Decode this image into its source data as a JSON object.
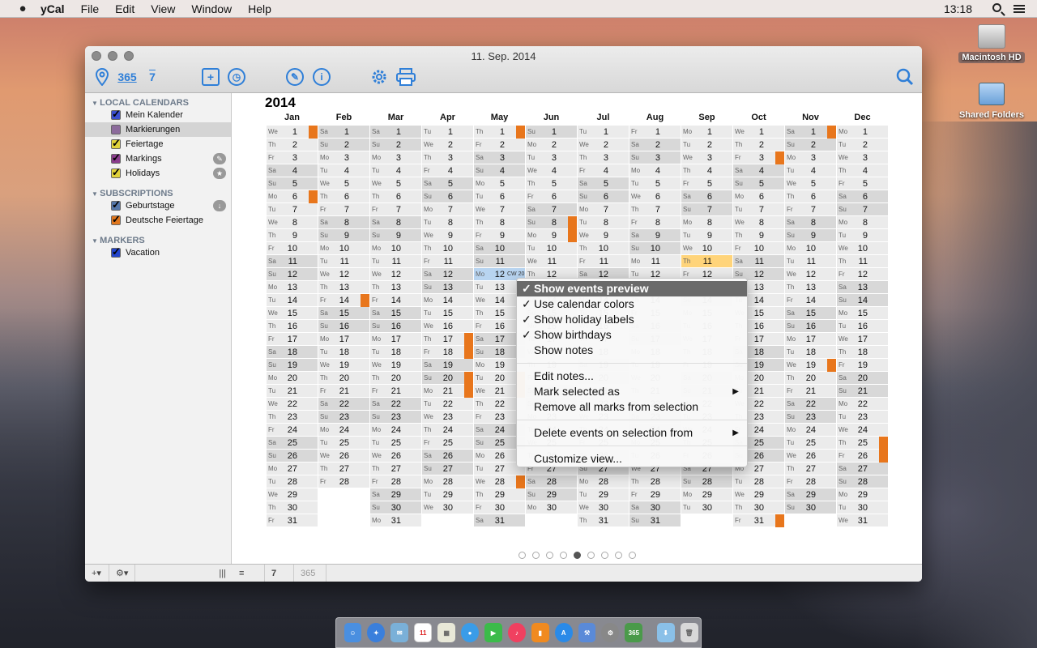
{
  "menubar": {
    "app": "yCal",
    "items": [
      "File",
      "Edit",
      "View",
      "Window",
      "Help"
    ],
    "time": "13:18"
  },
  "desktop": {
    "hd": "Macintosh HD",
    "shared": "Shared Folders"
  },
  "window": {
    "title": "11. Sep. 2014"
  },
  "toolbar": {
    "days365": "365",
    "seven": "7",
    "info": "i"
  },
  "sidebar": {
    "sections": [
      {
        "title": "LOCAL CALENDARS",
        "items": [
          {
            "label": "Mein Kalender",
            "color": "#3b4fcf",
            "checked": true
          },
          {
            "label": "Markierungen",
            "color": "#8c6b9c",
            "checked": false
          },
          {
            "label": "Feiertage",
            "color": "#e0d23a",
            "checked": true
          },
          {
            "label": "Markings",
            "color": "#8a3c8c",
            "checked": true
          },
          {
            "label": "Holidays",
            "color": "#e0d23a",
            "checked": true
          }
        ]
      },
      {
        "title": "SUBSCRIPTIONS",
        "items": [
          {
            "label": "Geburtstage",
            "color": "#5577aa",
            "checked": true
          },
          {
            "label": "Deutsche Feiertage",
            "color": "#e0761c",
            "checked": true
          }
        ]
      },
      {
        "title": "MARKERS",
        "items": [
          {
            "label": "Vacation",
            "color": "#2244cc",
            "checked": true
          }
        ]
      }
    ]
  },
  "bottombar": {
    "add": "+▾",
    "gear": "⚙▾",
    "week": "7",
    "year": "365"
  },
  "calendar": {
    "year": "2014",
    "months": [
      "Jan",
      "Feb",
      "Mar",
      "Apr",
      "May",
      "Jun",
      "Jul",
      "Aug",
      "Sep",
      "Oct",
      "Nov",
      "Dec"
    ],
    "days_in_month": [
      31,
      28,
      31,
      30,
      31,
      30,
      31,
      31,
      30,
      31,
      30,
      31
    ],
    "start_weekday": [
      2,
      5,
      5,
      1,
      3,
      6,
      1,
      4,
      0,
      2,
      5,
      0
    ],
    "weekday_abbr": [
      "Mo",
      "Tu",
      "We",
      "Th",
      "Fr",
      "Sa",
      "Su"
    ],
    "today": {
      "month": 8,
      "day": 11
    },
    "cw_label": "CW 20",
    "marks": [
      [
        0,
        1
      ],
      [
        0,
        6
      ],
      [
        1,
        14
      ],
      [
        4,
        1
      ],
      [
        3,
        17
      ],
      [
        3,
        18
      ],
      [
        3,
        20
      ],
      [
        3,
        21
      ],
      [
        4,
        20
      ],
      [
        4,
        21
      ],
      [
        4,
        28
      ],
      [
        5,
        8
      ],
      [
        5,
        9
      ],
      [
        9,
        3
      ],
      [
        9,
        31
      ],
      [
        10,
        1
      ],
      [
        10,
        19
      ],
      [
        11,
        25
      ],
      [
        11,
        26
      ]
    ]
  },
  "context_menu": {
    "items": [
      {
        "label": "Show events preview",
        "checked": true,
        "highlight": true
      },
      {
        "label": "Use calendar colors",
        "checked": true
      },
      {
        "label": "Show holiday labels",
        "checked": true
      },
      {
        "label": "Show birthdays",
        "checked": true
      },
      {
        "label": "Show notes",
        "checked": false
      },
      {
        "sep": true
      },
      {
        "label": "Edit notes..."
      },
      {
        "label": "Mark selected as",
        "submenu": true
      },
      {
        "label": "Remove all marks from selection"
      },
      {
        "sep": true
      },
      {
        "label": "Delete events on selection from",
        "submenu": true
      },
      {
        "sep": true
      },
      {
        "label": "Customize view..."
      }
    ]
  },
  "dock": {
    "cal_day": "11",
    "yc": "365"
  }
}
